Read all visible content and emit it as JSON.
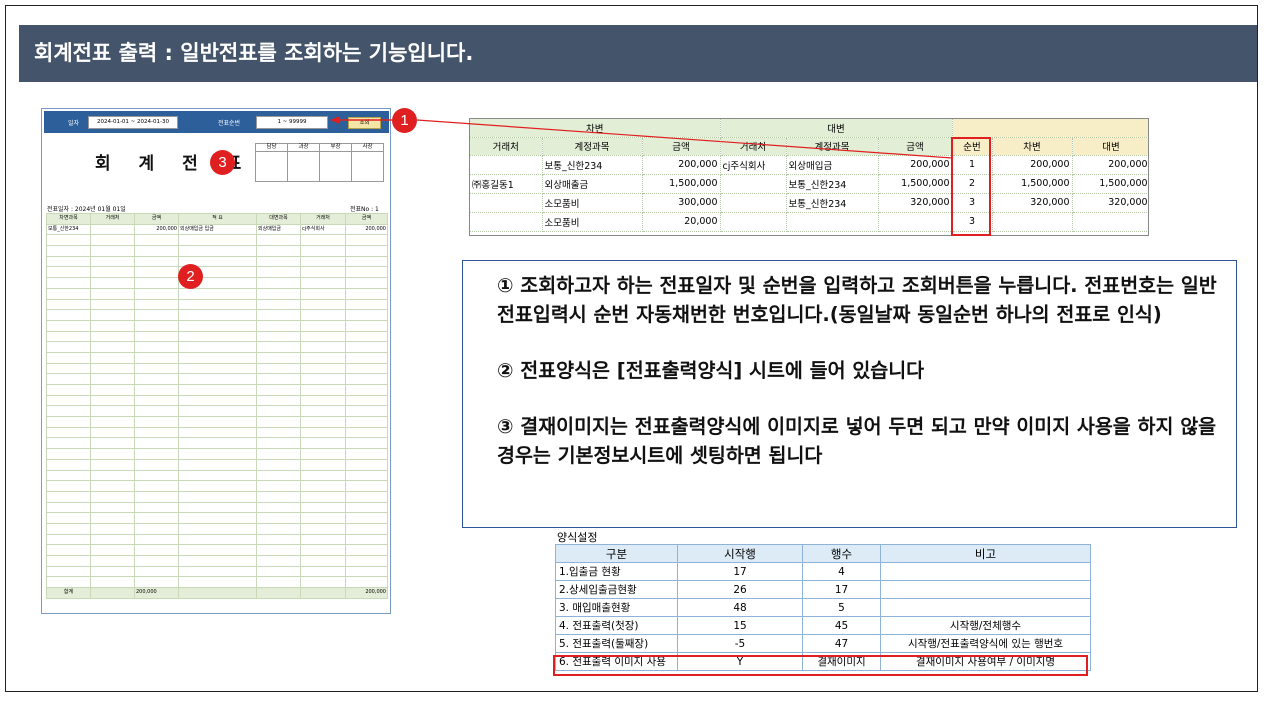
{
  "title": "회계전표 출력 : 일반전표를 조회하는 기능입니다.",
  "voucher": {
    "date_label": "일자",
    "date_range": "2024-01-01 ~ 2024-01-30",
    "seq_label": "전표순번",
    "seq_range": "1 ~  99999",
    "query_button": "조회",
    "title": "회 계 전 표",
    "sign_headers": [
      "담당",
      "과장",
      "부장",
      "사장"
    ],
    "date_line": "전표일자 : 2024년 01월 01일",
    "no_line": "전표No : 1",
    "columns": [
      "차변과목",
      "거래처",
      "금액",
      "적   요",
      "대변과목",
      "거래처",
      "금액"
    ],
    "rows": [
      [
        "보통_신한234",
        "",
        "200,000",
        "외상매입금 입금",
        "외상매입금",
        "cj주식회사",
        "200,000"
      ]
    ],
    "total_label": "합계",
    "total_debit": "200,000",
    "total_credit": "200,000"
  },
  "markers": {
    "one": "1",
    "two": "2",
    "three": "3"
  },
  "journal": {
    "group_debit": "차변",
    "group_credit": "대변",
    "columns": [
      "거래처",
      "계정과목",
      "금액",
      "거래처",
      "계정과목",
      "금액",
      "순번",
      "차변",
      "대변"
    ],
    "rows": [
      [
        "",
        "보통_신한234",
        "200,000",
        "cj주식회사",
        "외상매입금",
        "200,000",
        "1",
        "200,000",
        "200,000"
      ],
      [
        "㈜홍길동1",
        "외상매출금",
        "1,500,000",
        "",
        "보통_신한234",
        "1,500,000",
        "2",
        "1,500,000",
        "1,500,000"
      ],
      [
        "",
        "소모품비",
        "300,000",
        "",
        "보통_신한234",
        "320,000",
        "3",
        "320,000",
        "320,000"
      ],
      [
        "",
        "소모품비",
        "20,000",
        "",
        "",
        "",
        "3",
        "",
        ""
      ]
    ]
  },
  "description": {
    "p1": "① 조회하고자 하는 전표일자 및 순번을 입력하고 조회버튼을 누릅니다. 전표번호는 일반전표입력시 순번 자동채번한 번호입니다.(동일날짜 동일순번 하나의 전표로 인식)",
    "p2": "② 전표양식은 [전표출력양식] 시트에 들어 있습니다",
    "p3": "③ 결재이미지는 전표출력양식에 이미지로 넣어 두면 되고 만약 이미지 사용을 하지 않을 경우는 기본정보시트에 셋팅하면 됩니다"
  },
  "format_settings": {
    "label": "양식설정",
    "columns": [
      "구분",
      "시작행",
      "행수",
      "비고"
    ],
    "rows": [
      [
        "1.입출금 현황",
        "17",
        "4",
        ""
      ],
      [
        "2.상세입출금현황",
        "26",
        "17",
        ""
      ],
      [
        "3. 매입매출현황",
        "48",
        "5",
        ""
      ],
      [
        "4. 전표출력(첫장)",
        "15",
        "45",
        "시작행/전체행수"
      ],
      [
        "5. 전표출력(둘째장)",
        "-5",
        "47",
        "시작행/전표출력양식에 있는 행번호"
      ],
      [
        "6. 전표출력 이미지 사용",
        "Y",
        "결재이미지",
        "결재이미지 사용여부 / 이미지명"
      ]
    ]
  },
  "colors": {
    "title_bg": "#44546a",
    "marker_red": "#e02020",
    "header_blue": "#2d5f9a",
    "grid_green": "#e4edd8"
  }
}
